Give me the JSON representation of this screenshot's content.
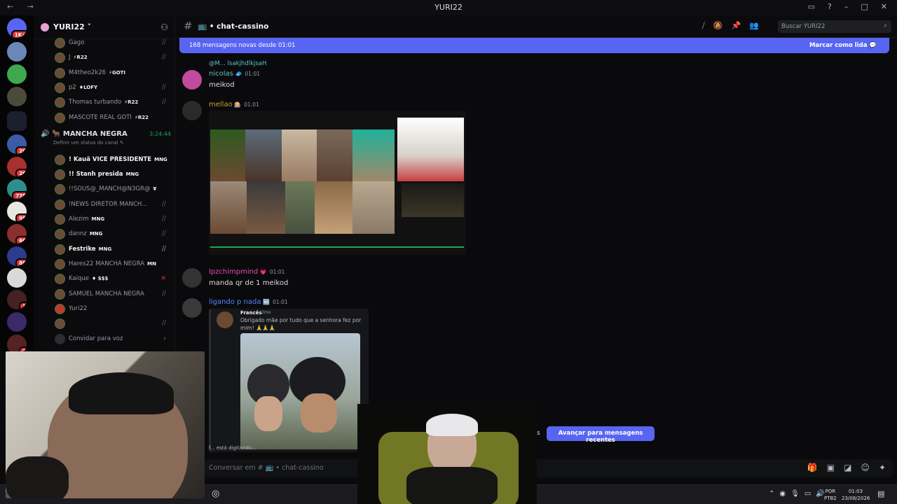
{
  "window": {
    "title": "YURI22",
    "nav": "← →"
  },
  "rail": {
    "badges": [
      "1K+",
      "20",
      "26",
      "775",
      "95",
      "66",
      "88",
      "3",
      "2"
    ]
  },
  "guild": {
    "name": "YURI22 ˅"
  },
  "voice_top": [
    {
      "name": "Gago",
      "tag": ""
    },
    {
      "name": "J",
      "tag": "⚡R22"
    },
    {
      "name": "M4theo2k26",
      "tag": "⚡GOTI"
    },
    {
      "name": "p2",
      "tag": "♦LOFY"
    },
    {
      "name": "Thomas turbando",
      "tag": "⚡R22"
    },
    {
      "name": "MASCOTE REAL GOTI",
      "tag": "⚡R22"
    }
  ],
  "voice_channel": {
    "name": "🐂 MANCHA NEGRA",
    "timer": "3:24:44",
    "status": "Definir um status do canal ✎"
  },
  "voice_members": [
    {
      "name": "! Kauã VICE PRESIDENTE",
      "tag": "MNG",
      "bold": true
    },
    {
      "name": "!! Stanh presida",
      "tag": "MNG",
      "bold": true
    },
    {
      "name": "!!SOUS@_MANCH@N3GR@",
      "tag": "¥",
      "bold": false
    },
    {
      "name": "!NEWS DIRETOR MANCH...",
      "tag": "",
      "bold": false
    },
    {
      "name": "Alezim",
      "tag": "MNG",
      "bold": false
    },
    {
      "name": "dannz",
      "tag": "MNG",
      "bold": false
    },
    {
      "name": "Festrike",
      "tag": "MNG",
      "bold": true
    },
    {
      "name": "Hares22 MANCHA NEGRA",
      "tag": "MN",
      "bold": false
    },
    {
      "name": "Kaique",
      "tag": "♦ $$$",
      "bold": false
    },
    {
      "name": "SAMUEL MANCHA NEGRA",
      "tag": "",
      "bold": false
    },
    {
      "name": "Yuri22",
      "tag": "",
      "bold": false
    },
    {
      "name": "",
      "tag": "",
      "bold": false
    }
  ],
  "invite_label": "Convidar para voz",
  "channel": {
    "name": "📺 • chat-cassino",
    "search_placeholder": "Buscar YURI22"
  },
  "new_messages": {
    "text": "168 mensagens novas desde 01:01",
    "action": "Marcar como lida 💬"
  },
  "messages": [
    {
      "reply": "@M...  lsakjhdlkjsaH",
      "author": "nicolas",
      "author_color": "#5ec2c7",
      "time": "01:01",
      "text": "meikod"
    },
    {
      "author": "mellao",
      "author_color": "#c9a03a",
      "time": "01:01",
      "text": ""
    },
    {
      "author": "lpzchimpmind",
      "author_color": "#e64bb6",
      "time": "01:01",
      "text": "manda qr de 1 meikod"
    },
    {
      "author": "ligando p nada",
      "author_color": "#5b83ff",
      "time": "01:01",
      "text": ""
    }
  ],
  "embed": {
    "name": "Francês",
    "date": "2mo",
    "text": "Obrigado mãe por tudo que a senhora fez por mim! 🙏🙏🙏"
  },
  "typing": "f... está digitando...",
  "jump_label": "Avançar para mensagens recentes",
  "jump_left": "as",
  "composer": {
    "placeholder": "Conversar em # 📺 • chat-cassino"
  },
  "taskbar": {
    "lang1": "POR",
    "lang2": "PTB2",
    "time": "01:03",
    "date": "23/08/2026"
  },
  "colors": {
    "accent": "#5865f2",
    "online": "#23a55a",
    "danger": "#da373c"
  }
}
